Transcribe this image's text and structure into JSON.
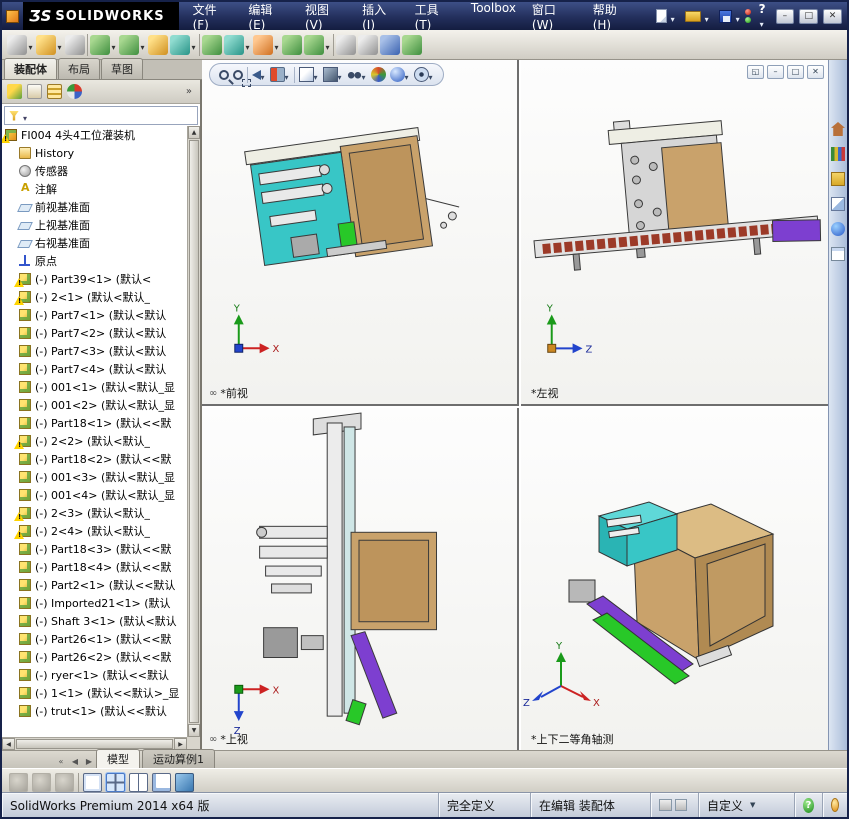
{
  "window": {
    "logo_mark": "ƷS",
    "logo_text": "SOLIDWORKS",
    "help_glyph": "?",
    "minimize_glyph": "–",
    "maximize_glyph": "□",
    "close_glyph": "✕"
  },
  "menus": [
    {
      "label": "文件(F)",
      "name": "menu-file"
    },
    {
      "label": "编辑(E)",
      "name": "menu-edit"
    },
    {
      "label": "视图(V)",
      "name": "menu-view"
    },
    {
      "label": "插入(I)",
      "name": "menu-insert"
    },
    {
      "label": "工具(T)",
      "name": "menu-tools"
    },
    {
      "label": "Toolbox",
      "name": "menu-toolbox"
    },
    {
      "label": "窗口(W)",
      "name": "menu-window"
    },
    {
      "label": "帮助(H)",
      "name": "menu-help"
    }
  ],
  "quick_access": [
    {
      "name": "new-document-icon",
      "k": "qa-new",
      "dd": "dd"
    },
    {
      "name": "open-icon",
      "k": "qa-open",
      "dd": "dd"
    },
    {
      "name": "save-icon",
      "k": "qa-save",
      "dd": "dd"
    }
  ],
  "toolbar": {
    "icons": [
      {
        "name": "screen-capture-icon",
        "k": "gr",
        "dd": "dd"
      },
      {
        "name": "insert-components-icon",
        "k": "y",
        "dd": "dd"
      },
      {
        "name": "attachment-icon",
        "k": "gr",
        "dd": ""
      },
      {
        "name": "toolbar-separator",
        "k": "sep",
        "dd": ""
      },
      {
        "name": "mate-icon",
        "k": "g",
        "dd": "dd"
      },
      {
        "name": "linear-component-pattern-icon",
        "k": "g",
        "dd": "dd"
      },
      {
        "name": "smart-fasteners-icon",
        "k": "y",
        "dd": ""
      },
      {
        "name": "move-component-icon",
        "k": "t",
        "dd": "dd"
      },
      {
        "name": "toolbar-separator",
        "k": "sep",
        "dd": ""
      },
      {
        "name": "show-hidden-components-icon",
        "k": "g",
        "dd": ""
      },
      {
        "name": "assembly-features-icon",
        "k": "t",
        "dd": "dd"
      },
      {
        "name": "reference-geometry-icon",
        "k": "o",
        "dd": "dd"
      },
      {
        "name": "new-motion-study-icon",
        "k": "g",
        "dd": ""
      },
      {
        "name": "bill-of-materials-icon",
        "k": "g",
        "dd": "dd"
      },
      {
        "name": "toolbar-separator",
        "k": "sep",
        "dd": ""
      },
      {
        "name": "exploded-view-icon",
        "k": "gr",
        "dd": ""
      },
      {
        "name": "interference-detection-icon",
        "k": "gr",
        "dd": ""
      },
      {
        "name": "measure-icon",
        "k": "b",
        "dd": ""
      },
      {
        "name": "mass-properties-icon",
        "k": "g",
        "dd": ""
      }
    ]
  },
  "left_panel": {
    "tabs": [
      {
        "label": "装配体",
        "k": "active",
        "name": "tab-assembly"
      },
      {
        "label": "布局",
        "k": "",
        "name": "tab-layout"
      },
      {
        "label": "草图",
        "k": "",
        "name": "tab-sketch"
      }
    ],
    "more_glyph": "»",
    "manager_icons": [
      {
        "name": "feature-manager-icon",
        "k": "m-feat"
      },
      {
        "name": "property-manager-icon",
        "k": "m-prop"
      },
      {
        "name": "configuration-manager-icon",
        "k": "m-conf"
      },
      {
        "name": "display-manager-icon",
        "k": "m-disp"
      }
    ]
  },
  "tree": {
    "items": [
      {
        "label": "FI004 4头4工位灌装机",
        "icon": "assembly",
        "w": "warn",
        "ind": "i0"
      },
      {
        "label": "History",
        "icon": "history",
        "w": "",
        "ind": "i1"
      },
      {
        "label": "传感器",
        "icon": "sensor",
        "w": "",
        "ind": "i1"
      },
      {
        "label": "注解",
        "icon": "annotation",
        "w": "",
        "ind": "i1"
      },
      {
        "label": "前视基准面",
        "icon": "plane",
        "w": "",
        "ind": "i1"
      },
      {
        "label": "上视基准面",
        "icon": "plane",
        "w": "",
        "ind": "i1"
      },
      {
        "label": "右视基准面",
        "icon": "plane",
        "w": "",
        "ind": "i1"
      },
      {
        "label": "原点",
        "icon": "origin",
        "w": "",
        "ind": "i1"
      },
      {
        "label": "(-) Part39<1> (默认<",
        "icon": "part",
        "w": "warn",
        "ind": "i1"
      },
      {
        "label": "(-) 2<1> (默认<默认_",
        "icon": "part",
        "w": "warn",
        "ind": "i1"
      },
      {
        "label": "(-) Part7<1> (默认<默认",
        "icon": "part",
        "w": "",
        "ind": "i1"
      },
      {
        "label": "(-) Part7<2> (默认<默认",
        "icon": "part",
        "w": "",
        "ind": "i1"
      },
      {
        "label": "(-) Part7<3> (默认<默认",
        "icon": "part",
        "w": "",
        "ind": "i1"
      },
      {
        "label": "(-) Part7<4> (默认<默认",
        "icon": "part",
        "w": "",
        "ind": "i1"
      },
      {
        "label": "(-) 001<1> (默认<默认_显",
        "icon": "part",
        "w": "",
        "ind": "i1"
      },
      {
        "label": "(-) 001<2> (默认<默认_显",
        "icon": "part",
        "w": "",
        "ind": "i1"
      },
      {
        "label": "(-) Part18<1> (默认<<默",
        "icon": "part",
        "w": "",
        "ind": "i1"
      },
      {
        "label": "(-) 2<2> (默认<默认_",
        "icon": "part",
        "w": "warn",
        "ind": "i1"
      },
      {
        "label": "(-) Part18<2> (默认<<默",
        "icon": "part",
        "w": "",
        "ind": "i1"
      },
      {
        "label": "(-) 001<3> (默认<默认_显",
        "icon": "part",
        "w": "",
        "ind": "i1"
      },
      {
        "label": "(-) 001<4> (默认<默认_显",
        "icon": "part",
        "w": "",
        "ind": "i1"
      },
      {
        "label": "(-) 2<3> (默认<默认_",
        "icon": "part",
        "w": "warn",
        "ind": "i1"
      },
      {
        "label": "(-) 2<4> (默认<默认_",
        "icon": "part",
        "w": "warn",
        "ind": "i1"
      },
      {
        "label": "(-) Part18<3> (默认<<默",
        "icon": "part",
        "w": "",
        "ind": "i1"
      },
      {
        "label": "(-) Part18<4> (默认<<默",
        "icon": "part",
        "w": "",
        "ind": "i1"
      },
      {
        "label": "(-) Part2<1> (默认<<默认",
        "icon": "part",
        "w": "",
        "ind": "i1"
      },
      {
        "label": "(-) Imported21<1> (默认",
        "icon": "part",
        "w": "",
        "ind": "i1"
      },
      {
        "label": "(-) Shaft 3<1> (默认<默认",
        "icon": "part",
        "w": "",
        "ind": "i1"
      },
      {
        "label": "(-) Part26<1> (默认<<默",
        "icon": "part",
        "w": "",
        "ind": "i1"
      },
      {
        "label": "(-) Part26<2> (默认<<默",
        "icon": "part",
        "w": "",
        "ind": "i1"
      },
      {
        "label": "(-) ryer<1> (默认<<默认",
        "icon": "part",
        "w": "",
        "ind": "i1"
      },
      {
        "label": "(-) 1<1> (默认<<默认>_显",
        "icon": "part",
        "w": "",
        "ind": "i1"
      },
      {
        "label": "(-) trut<1> (默认<<默认",
        "icon": "part",
        "w": "",
        "ind": "i1"
      }
    ]
  },
  "viewport": {
    "hud": [
      {
        "name": "zoom-to-fit-icon",
        "k": "h-mag",
        "dd": ""
      },
      {
        "name": "zoom-to-area-icon",
        "k": "h-magarea",
        "dd": ""
      },
      {
        "name": "hud-separator",
        "k": "h-sep",
        "dd": ""
      },
      {
        "name": "previous-view-icon",
        "k": "h-prev",
        "dd": "dd"
      },
      {
        "name": "section-view-icon",
        "k": "h-section",
        "dd": "dd"
      },
      {
        "name": "hud-separator",
        "k": "h-sep",
        "dd": ""
      },
      {
        "name": "view-orientation-icon",
        "k": "h-cube",
        "dd": "dd"
      },
      {
        "name": "display-style-icon",
        "k": "h-shaded",
        "dd": "dd"
      },
      {
        "name": "hide-show-items-icon",
        "k": "h-glasses",
        "dd": "dd"
      },
      {
        "name": "edit-appearance-icon",
        "k": "h-ball",
        "dd": ""
      },
      {
        "name": "apply-scene-icon",
        "k": "h-sphere",
        "dd": "dd"
      },
      {
        "name": "view-settings-icon",
        "k": "h-eye",
        "dd": "dd"
      }
    ],
    "window_buttons": [
      {
        "name": "viewport-restore-icon",
        "glyph": "◱"
      },
      {
        "name": "viewport-minimize-icon",
        "glyph": "–"
      },
      {
        "name": "viewport-maximize-icon",
        "glyph": "□"
      },
      {
        "name": "viewport-close-icon",
        "glyph": "✕"
      }
    ],
    "views": [
      {
        "label": "*前视",
        "link": "∞"
      },
      {
        "label": "*左视",
        "link": ""
      },
      {
        "label": "*上视",
        "link": "∞"
      },
      {
        "label": "*上下二等角轴测",
        "link": ""
      }
    ],
    "axes": {
      "x": "X",
      "y": "Y",
      "z": "Z"
    }
  },
  "task_pane": {
    "icons": [
      {
        "name": "resources-home-icon",
        "k": "tp-home"
      },
      {
        "name": "design-library-icon",
        "k": "tp-res"
      },
      {
        "name": "file-explorer-icon",
        "k": "tp-lib"
      },
      {
        "name": "view-palette-icon",
        "k": "tp-exp"
      },
      {
        "name": "appearances-scenes-icon",
        "k": "tp-app"
      },
      {
        "name": "custom-properties-icon",
        "k": "tp-doc"
      }
    ]
  },
  "bottom_tabs": {
    "nav": [
      {
        "glyph": "«",
        "name": "tabs-scroll-start-icon"
      },
      {
        "glyph": "◀",
        "name": "tabs-scroll-left-icon"
      },
      {
        "glyph": "▶",
        "name": "tabs-scroll-right-icon"
      }
    ],
    "tabs": [
      {
        "label": "模型",
        "k": "active",
        "name": "tab-model"
      },
      {
        "label": "运动算例1",
        "k": "",
        "name": "tab-motion-study-1"
      }
    ]
  },
  "bottom_toolbar": {
    "icons": [
      {
        "name": "zoom-control-icon",
        "k": "bt-dis"
      },
      {
        "name": "rotate-control-icon",
        "k": "bt-dis"
      },
      {
        "name": "pan-control-icon",
        "k": "bt-dis"
      },
      {
        "name": "bottom-separator",
        "k": "bt-sep"
      },
      {
        "name": "single-viewport-icon",
        "k": "bt-pane1"
      },
      {
        "name": "four-viewport-icon",
        "k": "bt-pane4on"
      },
      {
        "name": "two-viewport-icon",
        "k": "bt-pane2"
      },
      {
        "name": "link-views-icon",
        "k": "bt-panelink"
      },
      {
        "name": "image-capture-icon",
        "k": "bt-image"
      }
    ]
  },
  "status": {
    "product": "SolidWorks Premium 2014 x64 版",
    "definition": "完全定义",
    "editing": "在编辑 装配体",
    "custom": "自定义",
    "help_glyph": "?",
    "mini_icons": [
      {
        "name": "edit-component-indicator-icon"
      },
      {
        "name": "lightweight-indicator-icon"
      }
    ]
  }
}
